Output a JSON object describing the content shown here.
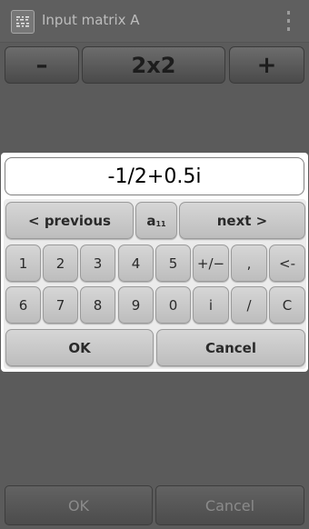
{
  "actionbar": {
    "title": "Input matrix A",
    "icon": "matrix-icon",
    "menu_icon": "overflow-menu-icon"
  },
  "size_row": {
    "minus": "–",
    "size": "2x2",
    "plus": "+"
  },
  "dialog": {
    "entry_value": "-1/2+0.5i",
    "nav": {
      "previous": "< previous",
      "cell_main": "a",
      "cell_sub": "11",
      "next": "next >"
    },
    "row1": [
      "1",
      "2",
      "3",
      "4",
      "5",
      "+/−",
      ",",
      "<-"
    ],
    "row2": [
      "6",
      "7",
      "8",
      "9",
      "0",
      "i",
      "/",
      "C"
    ],
    "ok": "OK",
    "cancel": "Cancel"
  },
  "bottom": {
    "ok": "OK",
    "cancel": "Cancel"
  }
}
